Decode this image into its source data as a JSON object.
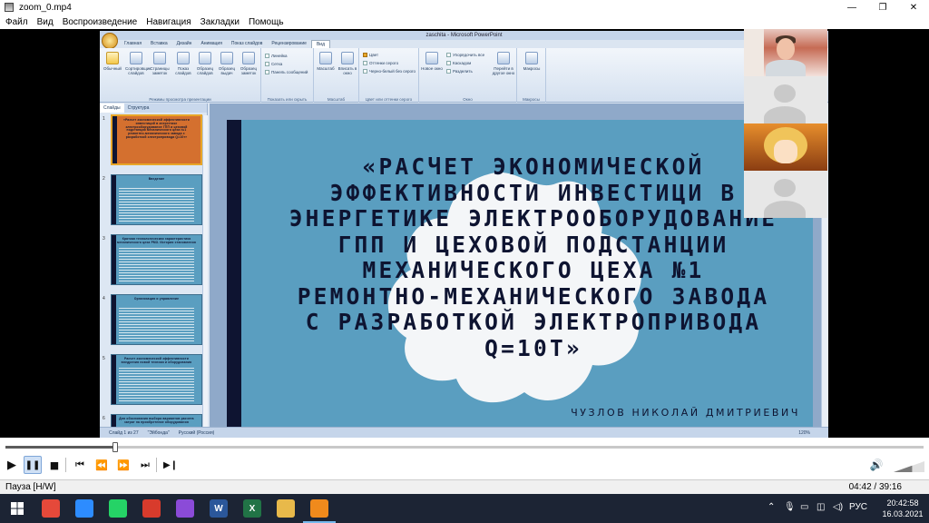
{
  "window": {
    "title": "zoom_0.mp4",
    "menu": [
      "Файл",
      "Вид",
      "Воспроизведение",
      "Навигация",
      "Закладки",
      "Помощь"
    ],
    "buttons": {
      "minimize": "—",
      "maximize": "❐",
      "close": "✕"
    }
  },
  "ppt": {
    "window_title": "zaschita - Microsoft PowerPoint",
    "tabs": [
      "Главная",
      "Вставка",
      "Дизайн",
      "Анимация",
      "Показ слайдов",
      "Рецензирование",
      "Вид"
    ],
    "active_tab": "Вид",
    "ribbon": {
      "view_buttons": [
        "Обычный",
        "Сортировщик слайдов",
        "Страницы заметок",
        "Показ слайдов",
        "Образец слайдов",
        "Образец выдач",
        "Образец заметок"
      ],
      "group_presentation_views": "Режимы просмотра презентации",
      "show_hide": [
        "Линейка",
        "Сетка",
        "Панель сообщений"
      ],
      "group_show_hide": "Показать или скрыть",
      "zoom_buttons": [
        "Масштаб",
        "Вписать в окно"
      ],
      "group_zoom": "Масштаб",
      "color_options": [
        "Цвет",
        "Оттенки серого",
        "Черно-белый без серого"
      ],
      "group_color": "Цвет или оттенки серого",
      "window_buttons": [
        "Новое окно",
        "Упорядочить все",
        "Каскадом",
        "Разделить",
        "Перейти в другое окно"
      ],
      "group_window": "Окно",
      "macros": "Макросы",
      "group_macros": "Макросы"
    },
    "panel_tabs": [
      "Слайды",
      "Структура"
    ],
    "thumbnails": [
      {
        "num": "1",
        "title": "«Расчет экономической эффективности инвестиций в энергетике электрооборудование ГПП и цеховой подстанции механического цеха №1 ремонтно-механического завода с разработкой электропривода Q=10т»"
      },
      {
        "num": "2",
        "title": "Введение"
      },
      {
        "num": "3",
        "title": "Краткая технологическая характеристика механического цеха РМЗ. История становления"
      },
      {
        "num": "4",
        "title": "Организация и управление"
      },
      {
        "num": "5",
        "title": "Расчет экономической эффективности внедрения новой техники и оборудования"
      },
      {
        "num": "6",
        "title": "Для обоснования выбора вариантов расчета затрат на приобретение оборудования"
      }
    ],
    "slide": {
      "title": "«РАСЧЕТ ЭКОНОМИЧЕСКОЙ ЭФФЕКТИВНОСТИ ИНВЕСТИЦИ В ЭНЕРГЕТИКЕ ЭЛЕКТРООБОРУДОВАНИЕ ГПП И ЦЕХОВОЙ ПОДСТАНЦИИ МЕХАНИЧЕСКОГО ЦЕХА №1 РЕМОНТНО-МЕХАНИЧЕСКОГО ЗАВОДА С РАЗРАБОТКОЙ ЭЛЕКТРОПРИВОДА Q=10Т»",
      "author": "ЧУЗЛОВ НИКОЛАЙ ДМИТРИЕВИЧ"
    },
    "status": {
      "slide": "Слайд 1 из 27",
      "theme": "\"Эйбонда\"",
      "language": "Русский (Россия)",
      "zoom": "120%"
    }
  },
  "player": {
    "status": "Пауза [H/W]",
    "time": "04:42 / 39:16",
    "progress": 0.12,
    "volume": 0.6,
    "buttons": {
      "play": "▶",
      "pause": "❚❚",
      "stop": "■",
      "prev": "⏮",
      "rewind": "⏪",
      "forward": "⏩",
      "next": "⏭",
      "frame": "▶❙",
      "volume": "🔊"
    }
  },
  "taskbar": {
    "apps": [
      {
        "name": "chrome-icon",
        "label": "",
        "color": "#e5493a"
      },
      {
        "name": "zoom-icon",
        "label": "",
        "color": "#2d8cff"
      },
      {
        "name": "whatsapp-icon",
        "label": "",
        "color": "#25d366"
      },
      {
        "name": "acrobat-icon",
        "label": "",
        "color": "#d83b2c"
      },
      {
        "name": "media-icon",
        "label": "",
        "color": "#8b4bd8"
      },
      {
        "name": "word-icon",
        "label": "W",
        "color": "#2b579a"
      },
      {
        "name": "excel-icon",
        "label": "X",
        "color": "#217346"
      },
      {
        "name": "explorer-icon",
        "label": "",
        "color": "#e8b94a"
      },
      {
        "name": "vlc-icon",
        "label": "",
        "color": "#f08a1c"
      }
    ],
    "lang": "РУС",
    "clock_time": "20:42:58",
    "clock_date": "16.03.2021"
  }
}
